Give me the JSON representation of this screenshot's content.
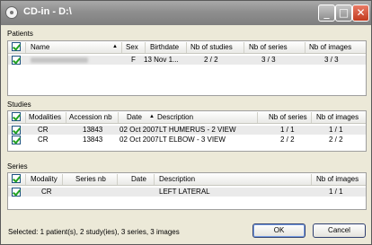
{
  "window": {
    "title": "CD-in - D:\\",
    "minimize": "_",
    "maximize": "□",
    "close": "✕"
  },
  "patients": {
    "label": "Patients",
    "columns": {
      "name": "Name",
      "sex": "Sex",
      "birthdate": "Birthdate",
      "studies": "Nb of studies",
      "series": "Nb of series",
      "images": "Nb of images"
    },
    "sort_indicator": "▲",
    "rows": [
      {
        "checked": true,
        "name_redacted": true,
        "sex": "F",
        "birthdate": "13 Nov 1...",
        "studies": "2 / 2",
        "series": "3 / 3",
        "images": "3 / 3"
      }
    ]
  },
  "studies": {
    "label": "Studies",
    "columns": {
      "modalities": "Modalities",
      "accession": "Accession nb",
      "date": "Date",
      "description": "Description",
      "series": "Nb of series",
      "images": "Nb of images"
    },
    "sort_indicator": "▲",
    "rows": [
      {
        "checked": true,
        "modalities": "CR",
        "accession": "13843",
        "date": "02 Oct 2007",
        "description": "LT HUMERUS - 2 VIEW",
        "series": "1 / 1",
        "images": "1 / 1"
      },
      {
        "checked": true,
        "modalities": "CR",
        "accession": "13843",
        "date": "02 Oct 2007",
        "description": "LT ELBOW - 3 VIEW",
        "series": "2 / 2",
        "images": "2 / 2"
      }
    ]
  },
  "series": {
    "label": "Series",
    "columns": {
      "modality": "Modality",
      "series_nb": "Series nb",
      "date": "Date",
      "description": "Description",
      "images": "Nb of images"
    },
    "rows": [
      {
        "checked": true,
        "modality": "CR",
        "series_nb": "",
        "date": "",
        "description": "LEFT LATERAL",
        "images": "1 / 1"
      }
    ]
  },
  "status": "Selected: 1 patient(s), 2 study(ies), 3 series, 3 images",
  "buttons": {
    "ok": "OK",
    "cancel": "Cancel"
  }
}
